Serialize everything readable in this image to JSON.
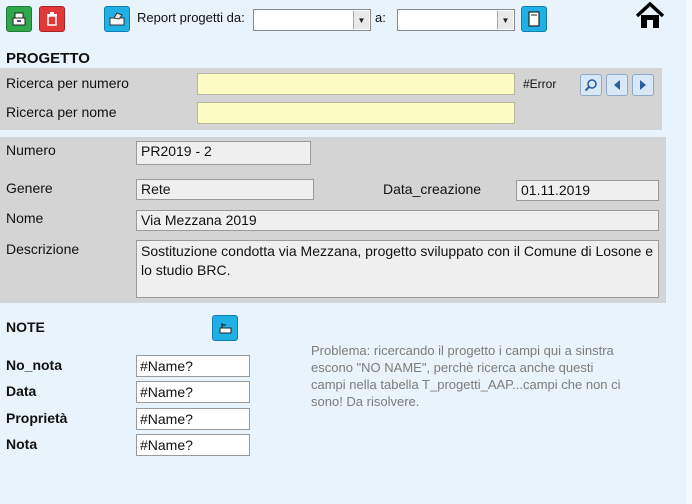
{
  "toolbar": {
    "report_label": "Report progetti da:",
    "to_label": "a:",
    "from_value": "",
    "to_value": ""
  },
  "progetto": {
    "title": "PROGETTO",
    "search_number_label": "Ricerca per numero",
    "search_name_label": "Ricerca per nome",
    "search_number_value": "",
    "search_name_value": "",
    "error_text": "#Error"
  },
  "details": {
    "numero_label": "Numero",
    "numero_value": "PR2019 - 2",
    "genere_label": "Genere",
    "genere_value": "Rete",
    "data_label": "Data_creazione",
    "data_value": "01.11.2019",
    "nome_label": "Nome",
    "nome_value": "Via Mezzana 2019",
    "descrizione_label": "Descrizione",
    "descrizione_value": "Sostituzione condotta via Mezzana, progetto sviluppato con il Comune di Losone e lo studio BRC."
  },
  "note": {
    "title": "NOTE",
    "no_nota_label": "No_nota",
    "no_nota_value": "#Name?",
    "data_label": "Data",
    "data_value": "#Name?",
    "proprieta_label": "Proprietà",
    "proprieta_value": "#Name?",
    "nota_label": "Nota",
    "nota_value": "#Name?",
    "comment": "Problema: ricercando il progetto i campi qui a sinstra escono \"NO NAME\", perchè ricerca anche questi campi nella tabella T_progetti_AAP...campi che non ci sono! Da risolvere."
  }
}
